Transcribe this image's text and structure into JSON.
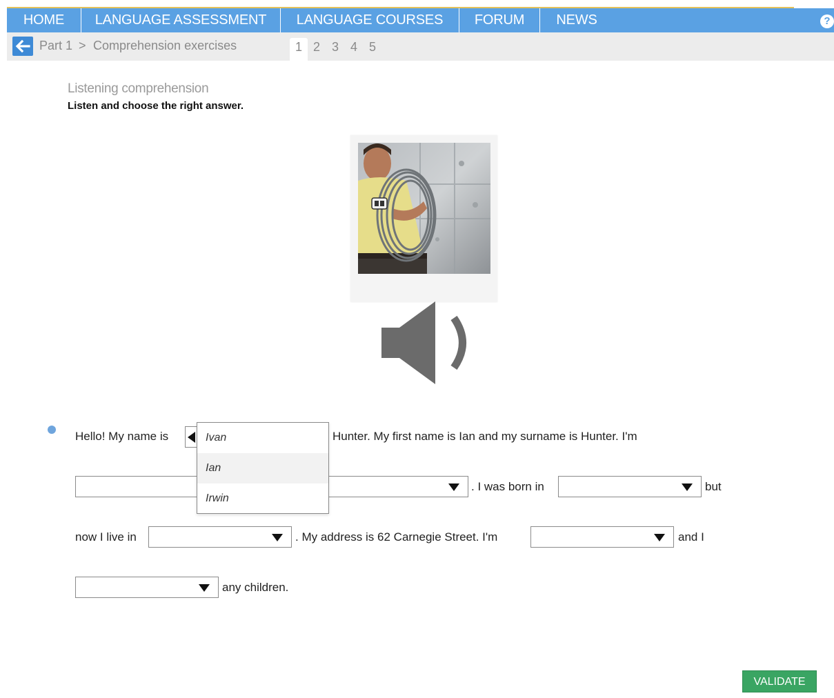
{
  "nav": {
    "items": [
      {
        "label": "HOME"
      },
      {
        "label": "LANGUAGE ASSESSMENT"
      },
      {
        "label": "LANGUAGE COURSES"
      },
      {
        "label": "FORUM"
      },
      {
        "label": "NEWS"
      }
    ],
    "help_label": "?",
    "icons": {
      "help": "help-icon"
    },
    "colors": {
      "nav_bg": "#5aa1e3",
      "accent_line": "#e3c15b"
    }
  },
  "breadcrumb": {
    "part": "Part 1",
    "separator": ">",
    "current": "Comprehension exercises",
    "back_icon": "arrow-left-icon"
  },
  "pager": {
    "pages": [
      "1",
      "2",
      "3",
      "4",
      "5"
    ],
    "active": "1"
  },
  "exercise": {
    "section_title": "Listening comprehension",
    "instruction": "Listen and choose the right answer.",
    "image_icon": "photo-man-with-cable",
    "audio_icon": "speaker-icon",
    "text": {
      "t1": "Hello! My name is",
      "t2": "Hunter. My first name is Ian and my surname is Hunter. I'm",
      "t3": ". I was born in",
      "t4": "but",
      "t5": "now I live in",
      "t6": ". My address is 62 Carnegie Street. I'm",
      "t7": "and I",
      "t8": "any children."
    },
    "dropdown_open": {
      "options": [
        "Ivan",
        "Ian",
        "Irwin"
      ],
      "highlighted": "Ian"
    }
  },
  "actions": {
    "validate_label": "VALIDATE",
    "validate_color": "#3aa563"
  }
}
